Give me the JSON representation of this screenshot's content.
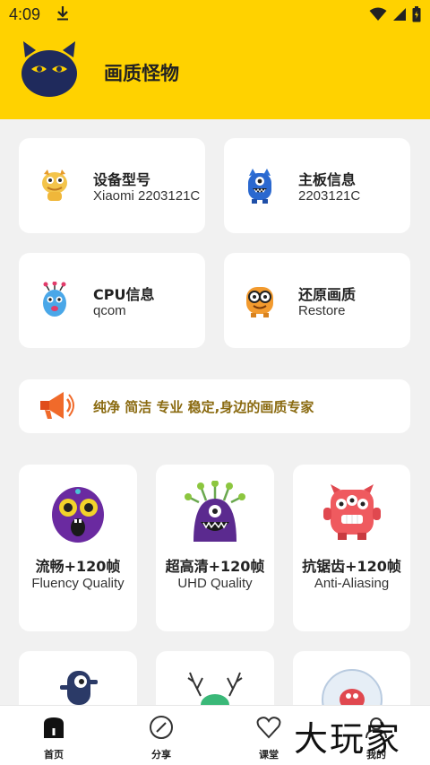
{
  "status_bar": {
    "time": "4:09"
  },
  "header": {
    "title": "画质怪物"
  },
  "info_cards": [
    {
      "label": "设备型号",
      "value": "Xiaomi 2203121C"
    },
    {
      "label": "主板信息",
      "value": "2203121C"
    },
    {
      "label": "CPU信息",
      "value": "qcom"
    },
    {
      "label": "还原画质",
      "value": "Restore"
    }
  ],
  "banner": {
    "text": "纯净 简洁 专业 稳定,身边的画质专家"
  },
  "quality_cards": [
    {
      "title": "流畅+120帧",
      "subtitle": "Fluency Quality"
    },
    {
      "title": "超高清+120帧",
      "subtitle": "UHD Quality"
    },
    {
      "title": "抗锯齿+120帧",
      "subtitle": "Anti-Aliasing"
    }
  ],
  "bottom_nav": [
    {
      "label": "首页",
      "icon": "home-icon"
    },
    {
      "label": "分享",
      "icon": "compass-icon"
    },
    {
      "label": "课堂",
      "icon": "heart-icon"
    },
    {
      "label": "我的",
      "icon": "profile-icon"
    }
  ],
  "watermark": "大玩家",
  "colors": {
    "accent": "#ffd200",
    "background": "#f1f1f1",
    "banner_text": "#8a6a10"
  }
}
